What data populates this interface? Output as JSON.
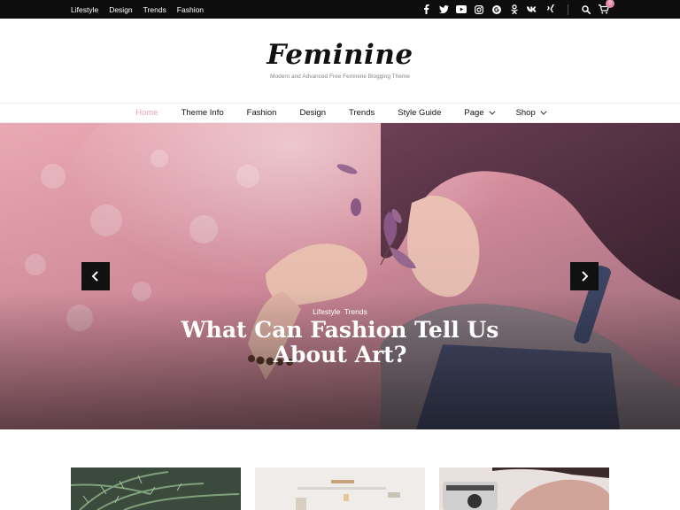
{
  "topbar": {
    "links": [
      "Lifestyle",
      "Design",
      "Trends",
      "Fashion"
    ],
    "social_icons": [
      "facebook-icon",
      "twitter-icon",
      "youtube-icon",
      "instagram-icon",
      "google-plus-icon",
      "odnoklassniki-icon",
      "vk-icon",
      "xing-icon"
    ],
    "cart_count": "0"
  },
  "brand": {
    "title": "Feminine",
    "tagline": "Modern and Advanced Free Feminine Blogging Theme"
  },
  "nav": {
    "items": [
      "Home",
      "Theme Info",
      "Fashion",
      "Design",
      "Trends",
      "Style Guide",
      "Page",
      "Shop"
    ],
    "active": "Home",
    "active_color": "#eaa6b8"
  },
  "hero": {
    "categories": [
      "Lifestyle",
      "Trends"
    ],
    "title": "What Can Fashion Tell Us About Art?"
  },
  "colors": {
    "topbar_bg": "#0d0d0d",
    "accent": "#eaa6b8"
  }
}
